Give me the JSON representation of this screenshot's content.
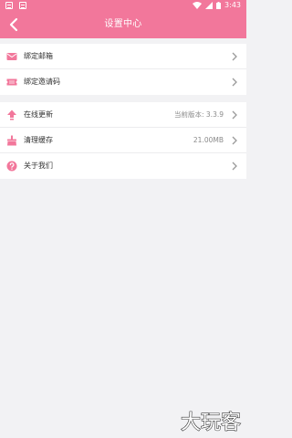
{
  "colors": {
    "accent": "#f2779b",
    "background": "#f2f2f4",
    "divider": "#ececee"
  },
  "status_bar": {
    "time": "3:43",
    "icons": [
      "notification-icon",
      "notification-icon",
      "wifi-icon",
      "signal-icon",
      "battery-icon"
    ]
  },
  "header": {
    "title": "设置中心",
    "back_icon": "back-arrow-icon"
  },
  "settings": {
    "group1": [
      {
        "label": "绑定邮箱",
        "icon": "mail-icon"
      },
      {
        "label": "绑定邀请码",
        "icon": "ticket-icon"
      }
    ],
    "group2": [
      {
        "label": "在线更新",
        "icon": "upload-icon",
        "value": "当前版本: 3.3.9"
      },
      {
        "label": "清理缓存",
        "icon": "broom-icon",
        "value": "21.00MB"
      },
      {
        "label": "关于我们",
        "icon": "help-icon"
      }
    ]
  },
  "watermark": {
    "text": "大玩客"
  }
}
